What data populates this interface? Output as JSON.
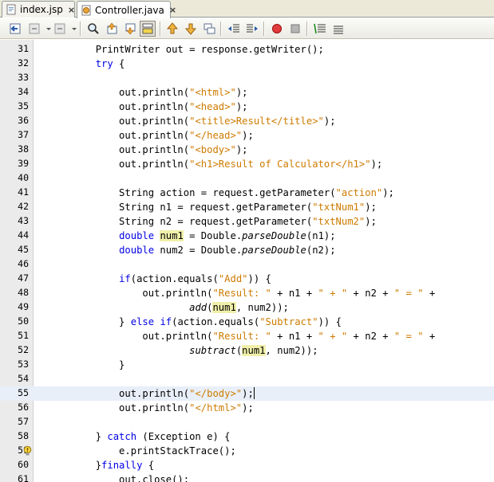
{
  "tabs": [
    {
      "label": "index.jsp",
      "active": false,
      "close": "×"
    },
    {
      "label": "Controller.java",
      "active": true,
      "close": "×"
    }
  ],
  "toolbar": [
    "back-to-last-edit",
    "last-edit-dropdown",
    "forward",
    "forward-dropdown",
    "find",
    "find-previous",
    "find-next",
    "toggle-highlight",
    "previous-bookmark",
    "next-bookmark",
    "toggle-bookmark",
    "shift-left",
    "shift-right",
    "start-macro",
    "stop-macro",
    "comment",
    "uncomment"
  ],
  "colors": {
    "keyword": "#0000e6",
    "string": "#ce7b00",
    "highlight": "#f0efaa",
    "current_line": "#e9eff8"
  },
  "editor": {
    "current_line": 55,
    "warning_line": 59,
    "lines": [
      {
        "n": "31",
        "text": "        PrintWriter out = response.getWriter();"
      },
      {
        "n": "32",
        "text": "        try {"
      },
      {
        "n": "33",
        "text": ""
      },
      {
        "n": "34",
        "text": "            out.println(\"<html>\");"
      },
      {
        "n": "35",
        "text": "            out.println(\"<head>\");"
      },
      {
        "n": "36",
        "text": "            out.println(\"<title>Result</title>\");"
      },
      {
        "n": "37",
        "text": "            out.println(\"</head>\");"
      },
      {
        "n": "38",
        "text": "            out.println(\"<body>\");"
      },
      {
        "n": "39",
        "text": "            out.println(\"<h1>Result of Calculator</h1>\");"
      },
      {
        "n": "40",
        "text": ""
      },
      {
        "n": "41",
        "text": "            String action = request.getParameter(\"action\");"
      },
      {
        "n": "42",
        "text": "            String n1 = request.getParameter(\"txtNum1\");"
      },
      {
        "n": "43",
        "text": "            String n2 = request.getParameter(\"txtNum2\");"
      },
      {
        "n": "44",
        "text": "            double num1 = Double.parseDouble(n1);"
      },
      {
        "n": "45",
        "text": "            double num2 = Double.parseDouble(n2);"
      },
      {
        "n": "46",
        "text": ""
      },
      {
        "n": "47",
        "text": "            if(action.equals(\"Add\")) {"
      },
      {
        "n": "48",
        "text": "                out.println(\"Result: \" + n1 + \" + \" + n2 + \" = \" +"
      },
      {
        "n": "49",
        "text": "                        add(num1, num2));"
      },
      {
        "n": "50",
        "text": "            } else if(action.equals(\"Subtract\")) {"
      },
      {
        "n": "51",
        "text": "                out.println(\"Result: \" + n1 + \" + \" + n2 + \" = \" +"
      },
      {
        "n": "52",
        "text": "                        subtract(num1, num2));"
      },
      {
        "n": "53",
        "text": "            }"
      },
      {
        "n": "54",
        "text": ""
      },
      {
        "n": "55",
        "text": "            out.println(\"</body>\");"
      },
      {
        "n": "56",
        "text": "            out.println(\"</html>\");"
      },
      {
        "n": "57",
        "text": ""
      },
      {
        "n": "58",
        "text": "        } catch (Exception e) {"
      },
      {
        "n": "59",
        "text": "            e.printStackTrace();"
      },
      {
        "n": "60",
        "text": "        }finally {"
      },
      {
        "n": "61",
        "text": "            out.close();"
      }
    ]
  }
}
